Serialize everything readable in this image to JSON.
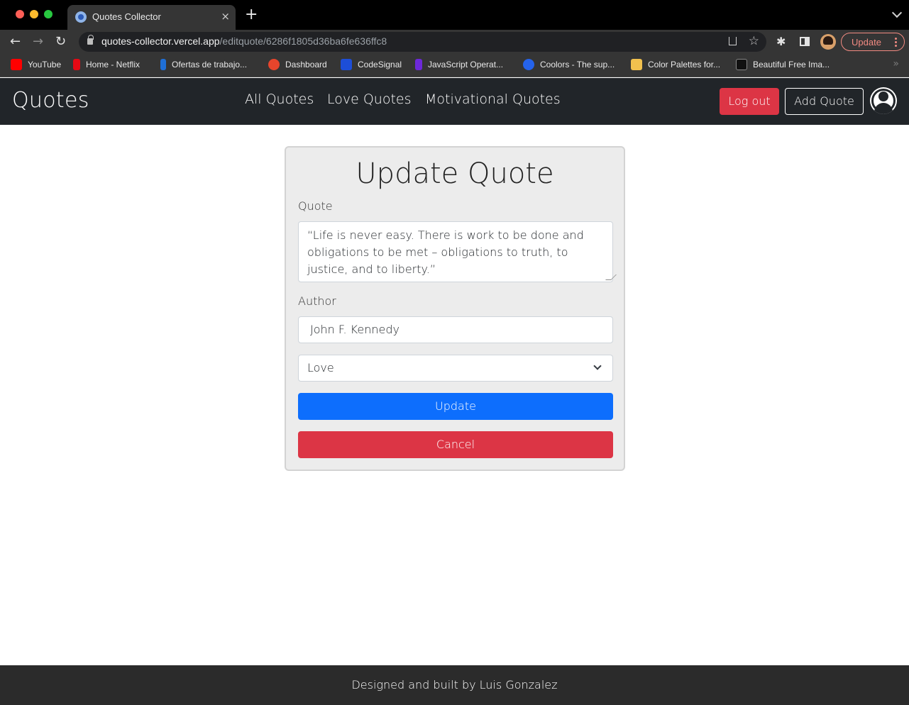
{
  "browser": {
    "tab_title": "Quotes Collector",
    "tab_close": "×",
    "new_tab": "+",
    "url_host": "quotes-collector.vercel.app",
    "url_path": "/editquote/6286f1805d36ba6fe636ffc8",
    "update_label": "Update",
    "bookmarks": [
      {
        "label": "YouTube",
        "color": "#ff0000"
      },
      {
        "label": "Home - Netflix",
        "color": "#e50914"
      },
      {
        "label": "Ofertas de trabajo...",
        "color": "#1f6fd6"
      },
      {
        "label": "Dashboard",
        "color": "#e8452c"
      },
      {
        "label": "CodeSignal",
        "color": "#1d4ed8"
      },
      {
        "label": "JavaScript Operat...",
        "color": "#6d28d9"
      },
      {
        "label": "Coolors - The sup...",
        "color": "#2563eb"
      },
      {
        "label": "Color Palettes for...",
        "color": "#f2c14e"
      },
      {
        "label": "Beautiful Free Ima...",
        "color": "#111111"
      }
    ],
    "bookmarks_more": "»"
  },
  "navbar": {
    "brand": "Quotes",
    "links": [
      "All Quotes",
      "Love Quotes",
      "Motivational Quotes"
    ],
    "logout_label": "Log out",
    "add_label": "Add Quote"
  },
  "form": {
    "title": "Update Quote",
    "quote_label": "Quote",
    "quote_value": "“Life is never easy. There is work to be done and obligations to be met – obligations to truth, to justice, and to liberty.”",
    "author_label": "Author",
    "author_value": "John F. Kennedy",
    "category_selected": "Love",
    "update_label": "Update",
    "cancel_label": "Cancel"
  },
  "footer": {
    "text": "Designed and built by Luis Gonzalez"
  },
  "colors": {
    "navbar_bg": "#212529",
    "danger": "#dc3545",
    "primary": "#0d6efd",
    "footer_bg": "#2b2b2b"
  }
}
